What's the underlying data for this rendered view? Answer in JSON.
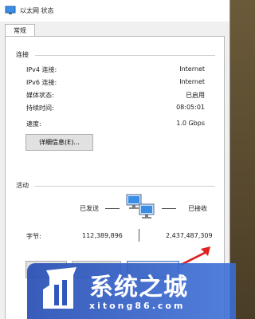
{
  "window": {
    "title": "以太网 状态"
  },
  "tabs": [
    {
      "label": "常规"
    }
  ],
  "connection": {
    "section_title": "连接",
    "rows": [
      {
        "label": "IPv4 连接:",
        "value": "Internet"
      },
      {
        "label": "IPv6 连接:",
        "value": "Internet"
      },
      {
        "label": "媒体状态:",
        "value": "已启用"
      },
      {
        "label": "持续时间:",
        "value": "08:05:01"
      },
      {
        "label": "速度:",
        "value": "1.0 Gbps"
      }
    ],
    "details_button": "详细信息(E)..."
  },
  "activity": {
    "section_title": "活动",
    "sent_label": "已发送",
    "received_label": "已接收",
    "bytes_label": "字节:",
    "bytes_sent": "112,389,896",
    "bytes_received": "2,437,487,309"
  },
  "watermark": {
    "title": "系统之城",
    "url": "xitong86.com"
  },
  "colors": {
    "arrow": "#e02020",
    "watermark_bg": "#2e58bf"
  }
}
